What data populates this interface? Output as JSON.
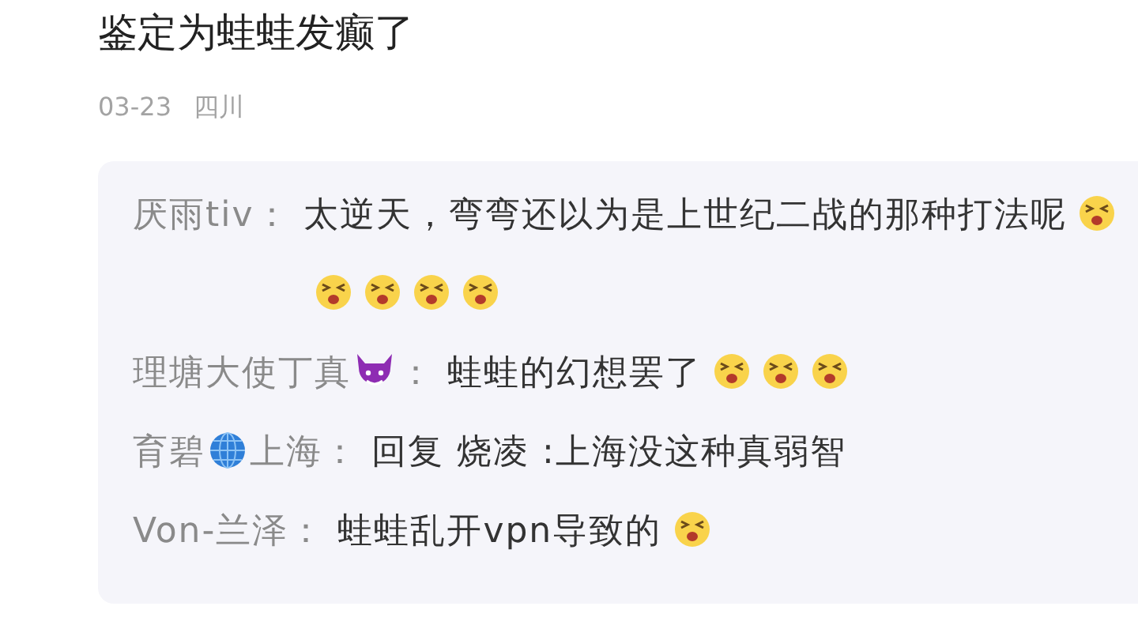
{
  "post": {
    "title": "鉴定为蛙蛙发癫了",
    "date": "03-23",
    "location": "四川"
  },
  "replies": [
    {
      "author": [
        {
          "kind": "text",
          "text": "厌雨tiv："
        }
      ],
      "text": "太逆天，弯弯还以为是上世纪二战的那种打法呢",
      "emojis": [
        {
          "kind": "squint"
        },
        {
          "kind": "squint"
        },
        {
          "kind": "squint"
        },
        {
          "kind": "squint"
        },
        {
          "kind": "squint"
        }
      ]
    },
    {
      "author": [
        {
          "kind": "text",
          "text": "理塘大使丁真"
        },
        {
          "kind": "devil"
        },
        {
          "kind": "text",
          "text": "："
        }
      ],
      "text": "蛙蛙的幻想罢了",
      "emojis": [
        {
          "kind": "squint"
        },
        {
          "kind": "squint"
        },
        {
          "kind": "squint"
        }
      ]
    },
    {
      "author": [
        {
          "kind": "text",
          "text": "育碧"
        },
        {
          "kind": "globe"
        },
        {
          "kind": "text",
          "text": "上海："
        }
      ],
      "text": "回复 烧凌 :上海没这种真弱智"
    },
    {
      "author": [
        {
          "kind": "text",
          "text": "Von-兰泽："
        }
      ],
      "text": "蛙蛙乱开vpn导致的",
      "emojis": [
        {
          "kind": "squint"
        }
      ]
    }
  ]
}
